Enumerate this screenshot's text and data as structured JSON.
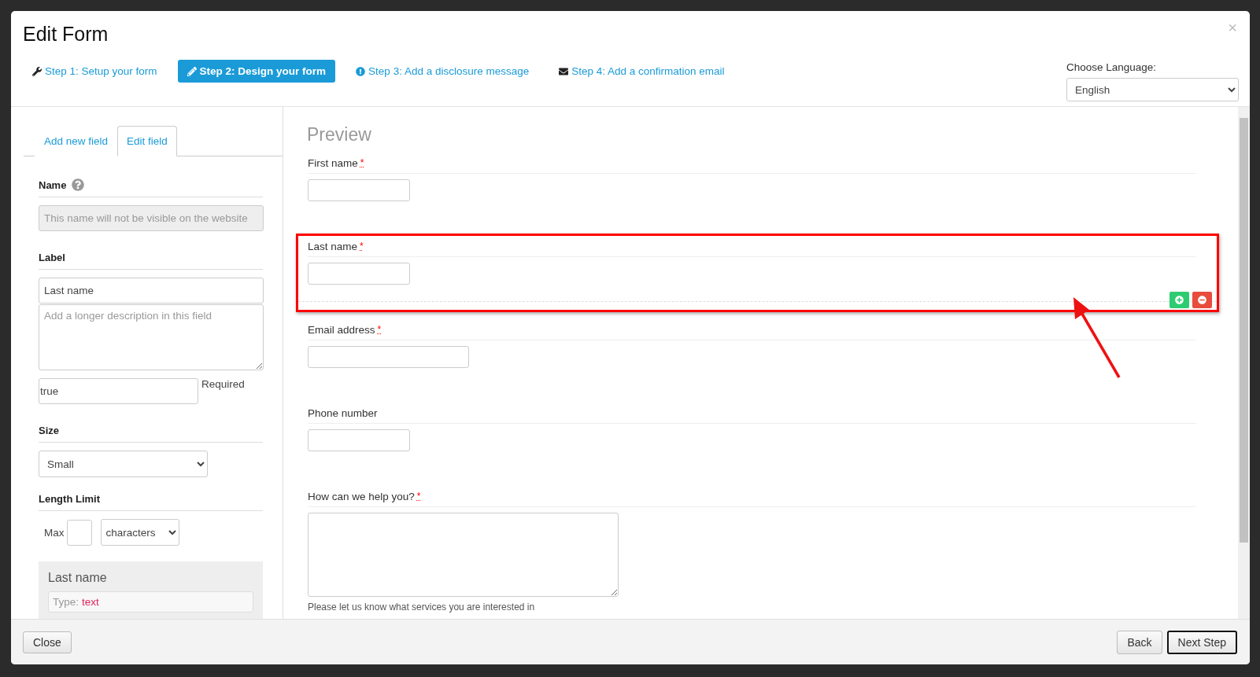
{
  "dialog": {
    "title": "Edit Form",
    "close_symbol": "×"
  },
  "steps": [
    {
      "label": "Step 1: Setup your form",
      "kind": "wrench",
      "selected": false
    },
    {
      "label": "Step 2: Design your form",
      "kind": "pencil",
      "selected": true
    },
    {
      "label": "Step 3: Add a disclosure message",
      "kind": "alert",
      "selected": false
    },
    {
      "label": "Step 4: Add a confirmation email",
      "kind": "envelope",
      "selected": false
    }
  ],
  "language": {
    "label": "Choose Language:",
    "value": "English"
  },
  "editor": {
    "tabs": [
      {
        "label": "Add new field",
        "selected": false
      },
      {
        "label": "Edit field",
        "selected": true
      }
    ],
    "name": {
      "label": "Name",
      "placeholder": "This name will not be visible on the website"
    },
    "label": {
      "label": "Label",
      "value": "Last name",
      "description_placeholder": "Add a longer description in this field"
    },
    "required": {
      "value": "true",
      "label": "Required"
    },
    "size": {
      "label": "Size",
      "value": "Small"
    },
    "length_limit": {
      "label": "Length Limit",
      "max_label": "Max",
      "unit": "characters"
    },
    "summary": {
      "title": "Last name",
      "type_label": "Type:",
      "type_value": "text"
    }
  },
  "preview": {
    "title": "Preview",
    "fields": [
      {
        "label": "First name",
        "required_mark": "*",
        "kind": "short",
        "highlighted": false
      },
      {
        "label": "Last name",
        "required_mark": "*",
        "kind": "short",
        "highlighted": true
      },
      {
        "label": "Email address",
        "required_mark": "*",
        "kind": "wide",
        "highlighted": false
      },
      {
        "label": "Phone number",
        "kind": "short",
        "highlighted": false
      },
      {
        "label": "How can we help you?",
        "required_mark": "*",
        "kind": "textarea",
        "highlighted": false,
        "help": "Please let us know what services you are interested in"
      }
    ]
  },
  "footer": {
    "close": "Close",
    "back": "Back",
    "next": "Next Step"
  }
}
